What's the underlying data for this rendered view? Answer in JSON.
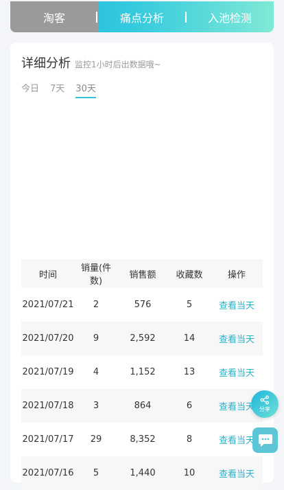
{
  "top_tabs": [
    {
      "label": "淘客"
    },
    {
      "label": "痛点分析"
    },
    {
      "label": "入池检测"
    }
  ],
  "card": {
    "title": "详细分析",
    "subtitle": "监控1小时后出数据哦~",
    "ranges": [
      {
        "label": "今日"
      },
      {
        "label": "7天"
      },
      {
        "label": "30天",
        "active": true
      }
    ]
  },
  "table": {
    "headers": [
      "时间",
      "销量(件数)",
      "销售额",
      "收藏数",
      "操作"
    ],
    "rows": [
      {
        "date": "2021/07/21",
        "sales": "2",
        "revenue": "576",
        "favorites": "5",
        "action": "查看当天"
      },
      {
        "date": "2021/07/20",
        "sales": "9",
        "revenue": "2,592",
        "favorites": "14",
        "action": "查看当天"
      },
      {
        "date": "2021/07/19",
        "sales": "4",
        "revenue": "1,152",
        "favorites": "13",
        "action": "查看当天"
      },
      {
        "date": "2021/07/18",
        "sales": "3",
        "revenue": "864",
        "favorites": "6",
        "action": "查看当天"
      },
      {
        "date": "2021/07/17",
        "sales": "29",
        "revenue": "8,352",
        "favorites": "8",
        "action": "查看当天"
      },
      {
        "date": "2021/07/16",
        "sales": "5",
        "revenue": "1,440",
        "favorites": "10",
        "action": "查看当天"
      }
    ]
  },
  "share": {
    "label": "分享",
    "icon": "share-icon"
  },
  "chat": {
    "icon": "chat-icon"
  },
  "colors": {
    "accent": "#27b2cc",
    "active_tab_bg": "#9a9a9a"
  }
}
